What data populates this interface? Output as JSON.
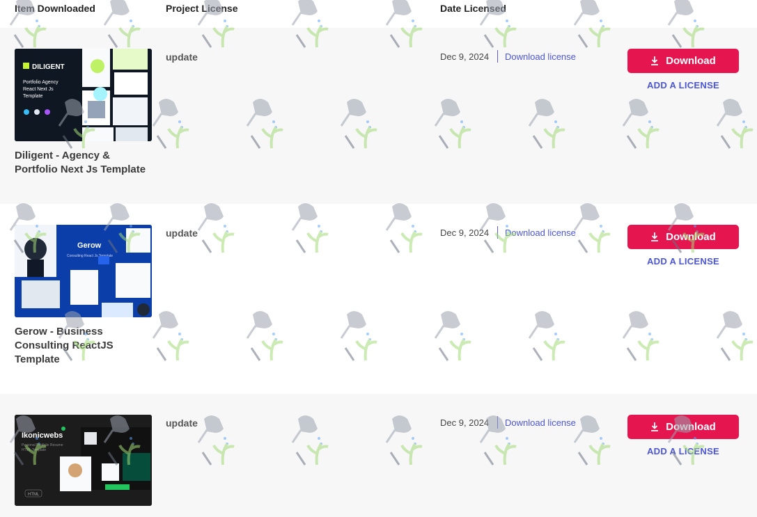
{
  "headers": {
    "item": "Item Downloaded",
    "license": "Project License",
    "date": "Date Licensed"
  },
  "items": [
    {
      "title": "Diligent - Agency & Portfolio Next Js Template",
      "thumb_brand": "DILIGENT",
      "thumb_caption": "Portfolio Agency React Next Js Template",
      "license": "update",
      "date": "Dec 9, 2024",
      "download_license": "Download license",
      "download_label": "Download",
      "add_license": "ADD A LICENSE"
    },
    {
      "title": "Gerow - Business Consulting ReactJS Template",
      "thumb_brand": "Gerow",
      "thumb_caption": "Consulting React Js Template",
      "license": "update",
      "date": "Dec 9, 2024",
      "download_license": "Download license",
      "download_label": "Download",
      "add_license": "ADD A LICENSE"
    },
    {
      "title": "",
      "thumb_brand": "Ikonicwebs",
      "thumb_caption": "Personal Portfolio Resume HTML Template",
      "thumb_tag": "HTML",
      "license": "update",
      "date": "Dec 9, 2024",
      "download_license": "Download license",
      "download_label": "Download",
      "add_license": "ADD A LICENSE"
    }
  ],
  "colors": {
    "accent": "#e4154f",
    "link": "#4b55d4",
    "row_shade": "#f7f7f8"
  },
  "icons": {
    "download": "download-icon",
    "watermark": "watering-can-plant-icon"
  }
}
